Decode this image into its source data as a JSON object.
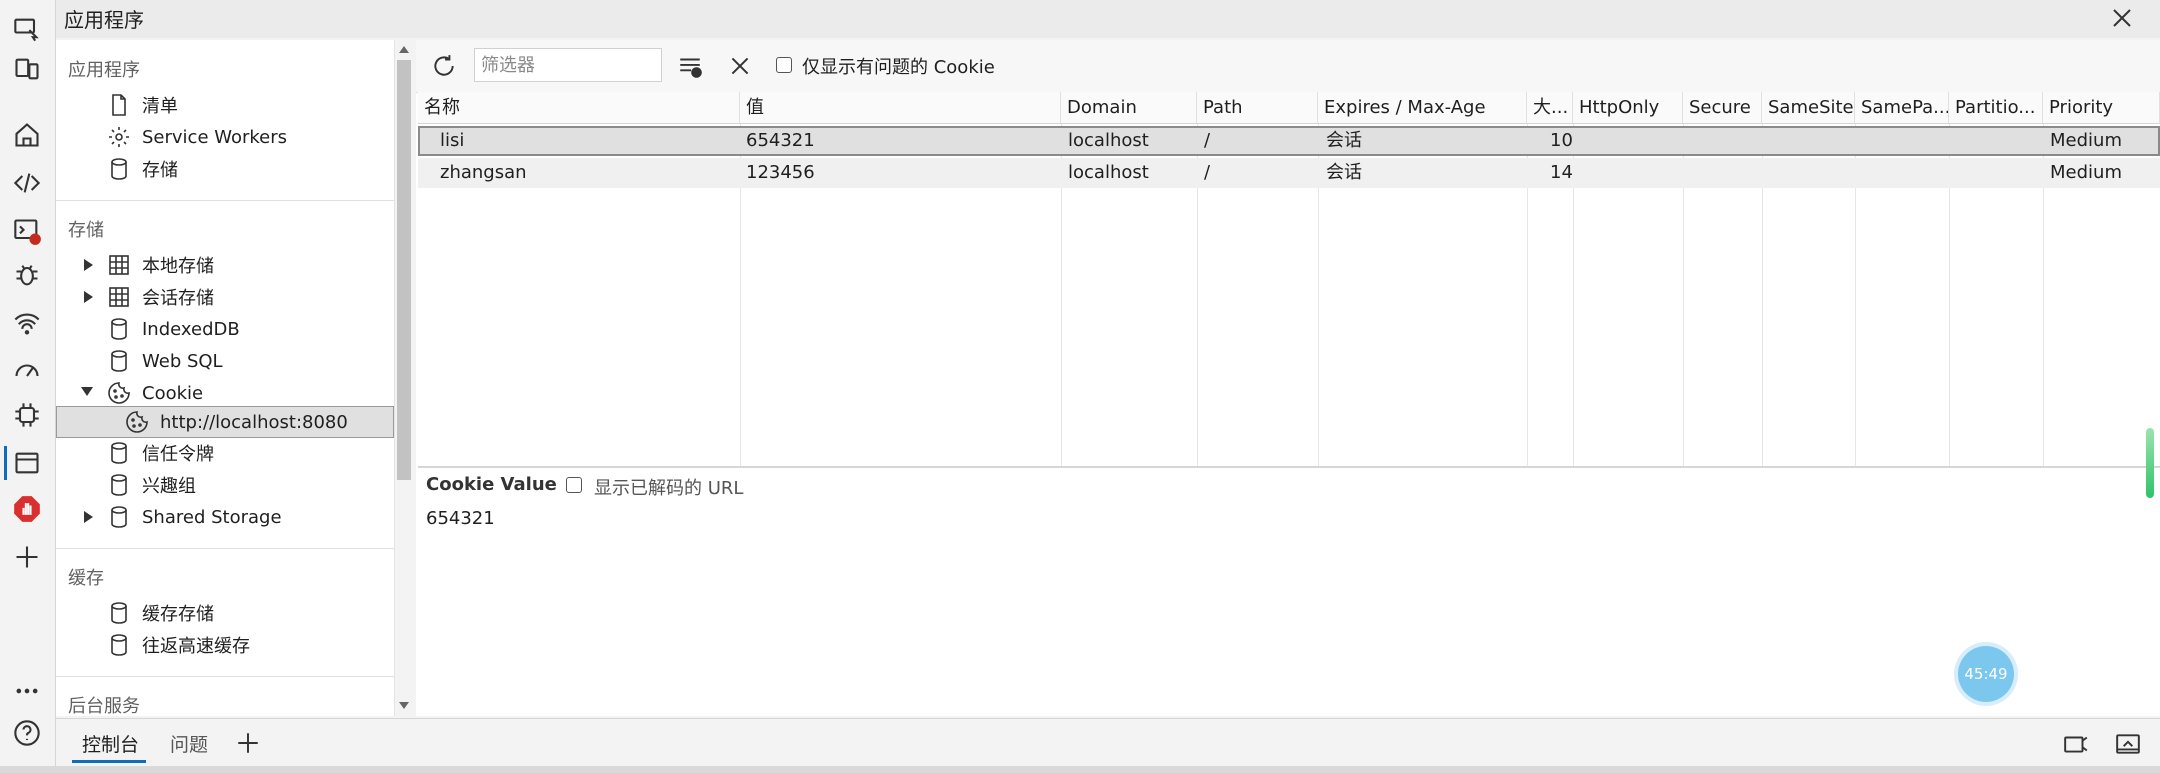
{
  "window": {
    "title": "应用程序"
  },
  "sidebar": {
    "sections": {
      "application": "应用程序",
      "storage": "存储",
      "cache": "缓存",
      "background": "后台服务"
    },
    "app_items": [
      "清单",
      "Service Workers",
      "存储"
    ],
    "storage_items": [
      "本地存储",
      "会话存储",
      "IndexedDB",
      "Web SQL",
      "Cookie",
      "http://localhost:8080",
      "信任令牌",
      "兴趣组",
      "Shared Storage"
    ],
    "cache_items": [
      "缓存存储",
      "往返高速缓存"
    ]
  },
  "toolbar": {
    "filter_placeholder": "筛选器",
    "only_issues_label": "仅显示有问题的 Cookie"
  },
  "table": {
    "columns": [
      "名称",
      "值",
      "Domain",
      "Path",
      "Expires / Max-Age",
      "大...",
      "HttpOnly",
      "Secure",
      "SameSite",
      "SamePa...",
      "Partitio...",
      "Priority"
    ],
    "rows": [
      {
        "name": "lisi",
        "value": "654321",
        "domain": "localhost",
        "path": "/",
        "expires": "会话",
        "size": "10",
        "priority": "Medium"
      },
      {
        "name": "zhangsan",
        "value": "123456",
        "domain": "localhost",
        "path": "/",
        "expires": "会话",
        "size": "14",
        "priority": "Medium"
      }
    ]
  },
  "detail": {
    "title": "Cookie Value",
    "decode_label": "显示已解码的 URL",
    "value": "654321"
  },
  "timer": "45:49",
  "drawer": {
    "tabs": [
      "控制台",
      "问题"
    ]
  }
}
